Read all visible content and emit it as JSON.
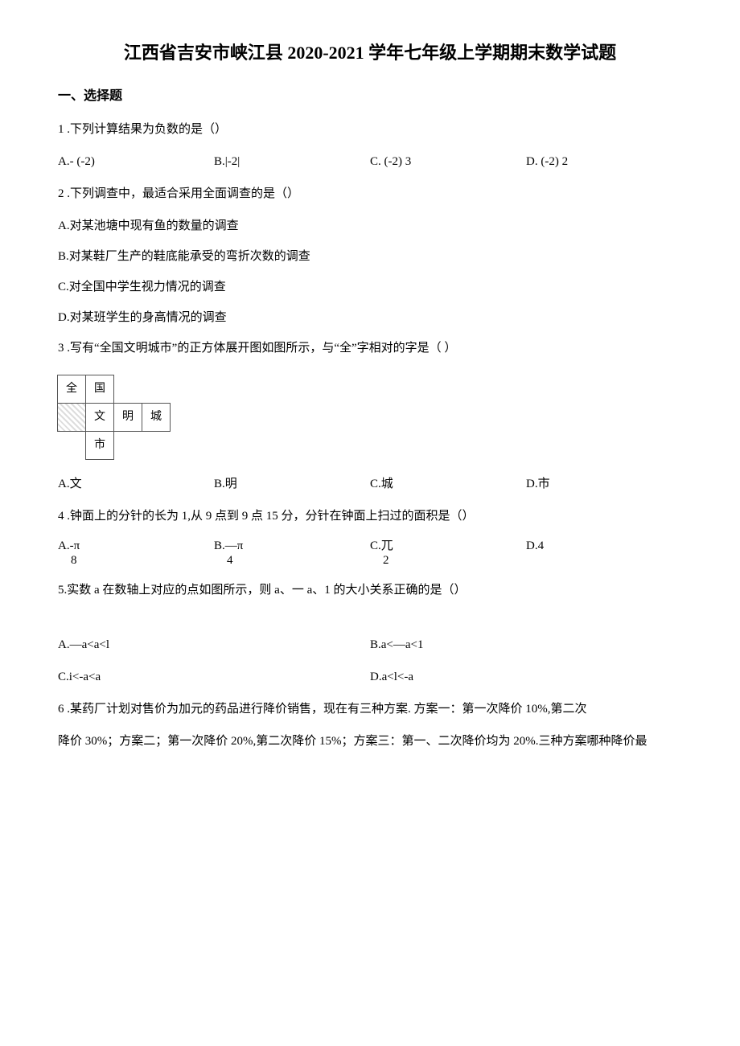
{
  "title": "江西省吉安市峡江县 2020-2021 学年七年级上学期期末数学试题",
  "section1": "一、选择题",
  "q1": {
    "stem": "1 .下列计算结果为负数的是（）",
    "A": "A.- (-2)",
    "B": "B.|-2|",
    "C": "C. (-2) 3",
    "D": "D. (-2) 2"
  },
  "q2": {
    "stem": "2 .下列调查中，最适合采用全面调查的是（）",
    "A": "A.对某池塘中现有鱼的数量的调查",
    "B": "B.对某鞋厂生产的鞋底能承受的弯折次数的调查",
    "C": "C.对全国中学生视力情况的调查",
    "D": "D.对某班学生的身高情况的调查"
  },
  "q3": {
    "stem": "3 .写有“全国文明城市”的正方体展开图如图所示，与“全”字相对的字是（        ）",
    "net": {
      "r1": [
        "全",
        "国"
      ],
      "r2": [
        "",
        "文",
        "明",
        "城"
      ],
      "r3": [
        "",
        "市"
      ]
    },
    "A": "A.文",
    "B": "B.明",
    "C": "C.城",
    "D": "D.市"
  },
  "q4": {
    "stem": "4 .钟面上的分针的长为 1,从 9 点到 9 点 15 分，分针在钟面上扫过的面积是（）",
    "A_top": "A.-π",
    "A_bot": "8",
    "B_top": "B.—π",
    "B_bot": "4",
    "C_top": "C.兀",
    "C_bot": "2",
    "D_top": "D.4"
  },
  "q5": {
    "stem": "5.实数 a 在数轴上对应的点如图所示，则 a、一 a、1 的大小关系正确的是（）",
    "A": "A.—a<a<l",
    "B": "B.a<—a<1",
    "C": "C.i<-a<a",
    "D": "D.a<l<-a"
  },
  "q6": {
    "line1": "6 .某药厂计划对售价为加元的药品进行降价销售，现在有三种方案. 方案一：第一次降价 10%,第二次",
    "line2": "降价 30%；方案二；第一次降价 20%,第二次降价 15%；方案三：第一、二次降价均为 20%.三种方案哪种降价最"
  }
}
